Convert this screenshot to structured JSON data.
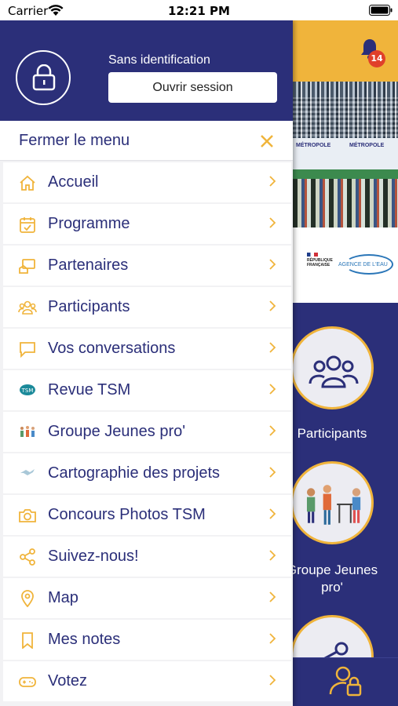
{
  "status_bar": {
    "carrier": "Carrier",
    "time": "12:21 PM"
  },
  "session": {
    "status_text": "Sans identification",
    "login_button": "Ouvrir session"
  },
  "menu": {
    "close_label": "Fermer le menu",
    "items": [
      {
        "label": "Accueil",
        "icon": "home-icon"
      },
      {
        "label": "Programme",
        "icon": "calendar-icon"
      },
      {
        "label": "Partenaires",
        "icon": "handshake-icon"
      },
      {
        "label": "Participants",
        "icon": "people-icon"
      },
      {
        "label": "Vos conversations",
        "icon": "chat-icon"
      },
      {
        "label": "Revue TSM",
        "icon": "tsm-logo-icon"
      },
      {
        "label": "Groupe Jeunes pro'",
        "icon": "young-pro-icon"
      },
      {
        "label": "Cartographie des projets",
        "icon": "map-fold-icon"
      },
      {
        "label": "Concours Photos TSM",
        "icon": "camera-icon"
      },
      {
        "label": "Suivez-nous!",
        "icon": "share-icon"
      },
      {
        "label": "Map",
        "icon": "location-pin-icon"
      },
      {
        "label": "Mes notes",
        "icon": "bookmark-icon"
      },
      {
        "label": "Votez",
        "icon": "gamepad-icon"
      }
    ]
  },
  "background_app": {
    "notification_count": "14",
    "banner_text_left": "MÉTROPOLE",
    "banner_text_right": "MÉTROPOLE",
    "logo_left_text": "RÉPUBLIQUE FRANÇAISE",
    "logo_right_text": "AGENCE DE L'EAU",
    "cards": [
      {
        "label": "Participants"
      },
      {
        "label": "Groupe Jeunes pro'"
      }
    ]
  },
  "colors": {
    "navy": "#2b2f79",
    "accent": "#f0b43b",
    "badge": "#e0402a"
  }
}
